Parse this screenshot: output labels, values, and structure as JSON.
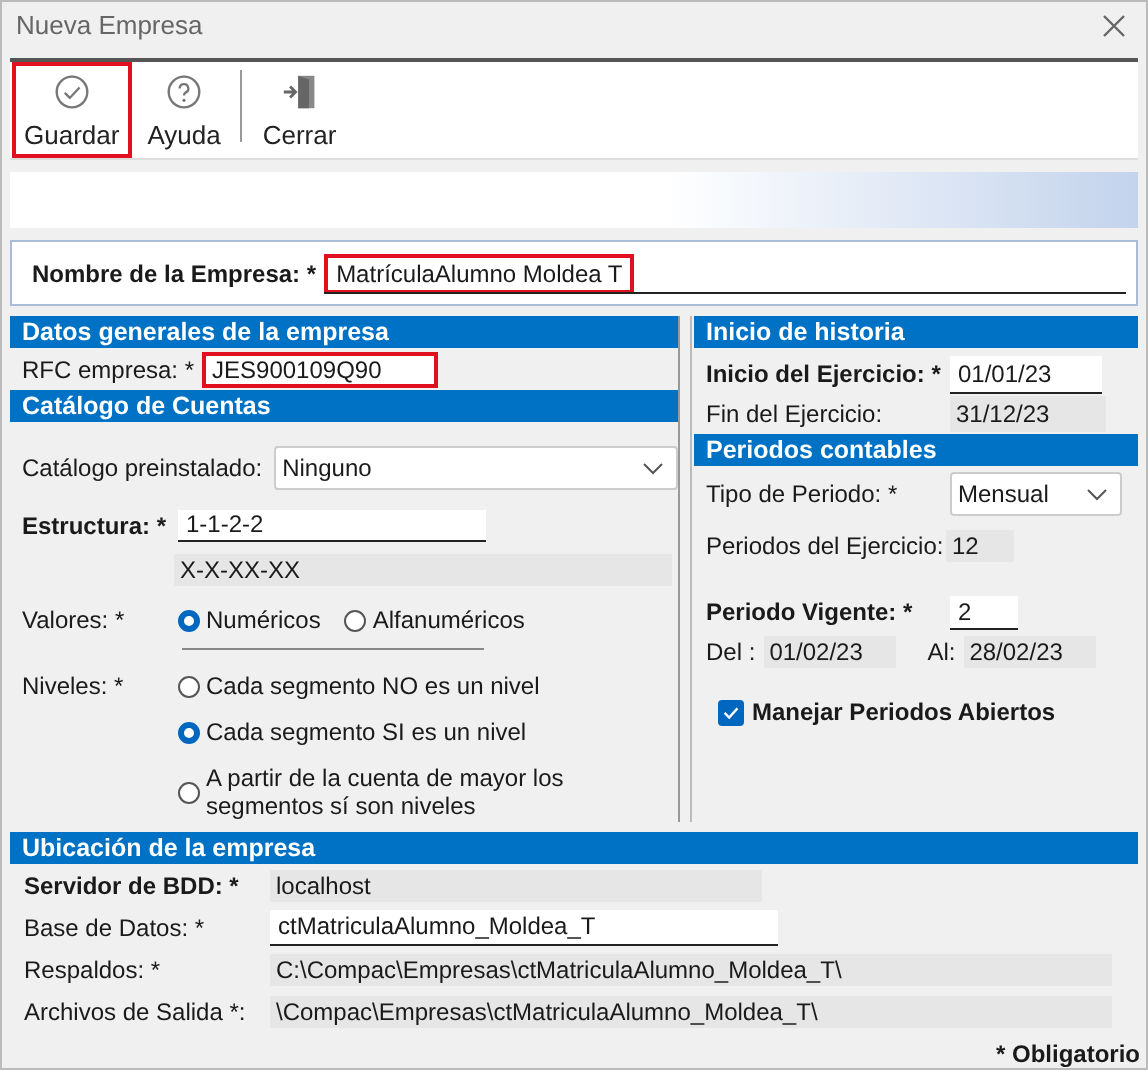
{
  "window": {
    "title": "Nueva Empresa"
  },
  "toolbar": [
    {
      "label": "Guardar",
      "kind": "check",
      "highlighted": true
    },
    {
      "label": "Ayuda",
      "kind": "help",
      "highlighted": false
    },
    {
      "label": "Cerrar",
      "kind": "exit",
      "highlighted": false
    }
  ],
  "company_name": {
    "label": "Nombre de la Empresa: *",
    "value": "MatrículaAlumno Moldea T",
    "highlighted": true
  },
  "general": {
    "title": "Datos generales de la empresa",
    "rfc": {
      "label": "RFC empresa: *",
      "value": "JES900109Q90",
      "highlighted": true
    }
  },
  "catalog": {
    "title": "Catálogo de Cuentas",
    "preinstalled": {
      "label": "Catálogo preinstalado:",
      "value": "Ninguno"
    },
    "structure": {
      "label": "Estructura: *",
      "value": "1-1-2-2",
      "mask": "X-X-XX-XX"
    },
    "values": {
      "label": "Valores: *",
      "options": [
        {
          "label": "Numéricos",
          "selected": true
        },
        {
          "label": "Alfanuméricos",
          "selected": false
        }
      ]
    },
    "levels": {
      "label": "Niveles: *",
      "options": [
        {
          "label": "Cada segmento NO es un nivel",
          "selected": false
        },
        {
          "label": "Cada segmento SI es un nivel",
          "selected": true
        },
        {
          "label": "A partir de la cuenta de mayor los segmentos sí son niveles",
          "selected": false
        }
      ]
    }
  },
  "history": {
    "title": "Inicio de historia",
    "start": {
      "label": "Inicio del Ejercicio: *",
      "value": "01/01/23"
    },
    "end": {
      "label": "Fin del Ejercicio:",
      "value": "31/12/23"
    }
  },
  "periods": {
    "title": "Periodos contables",
    "type": {
      "label": "Tipo de Periodo: *",
      "value": "Mensual"
    },
    "count": {
      "label": "Periodos del Ejercicio:",
      "value": "12"
    },
    "current": {
      "label": "Periodo Vigente: *",
      "value": "2"
    },
    "from": {
      "label": "Del :",
      "value": "01/02/23"
    },
    "to": {
      "label": "Al:",
      "value": "28/02/23"
    },
    "open_periods": {
      "label": "Manejar Periodos Abiertos",
      "checked": true
    }
  },
  "location": {
    "title": "Ubicación de la empresa",
    "rows": [
      {
        "label": "Servidor de BDD: *",
        "value": "localhost",
        "kind": "readonly"
      },
      {
        "label": "Base de Datos: *",
        "value": "ctMatriculaAlumno_Moldea_T",
        "kind": "input"
      },
      {
        "label": "Respaldos: *",
        "value": "C:\\Compac\\Empresas\\ctMatriculaAlumno_Moldea_T\\",
        "kind": "readonly-wide"
      },
      {
        "label": "Archivos de Salida *:",
        "value": "\\Compac\\Empresas\\ctMatriculaAlumno_Moldea_T\\",
        "kind": "readonly-wide"
      }
    ]
  },
  "footer": "* Obligatorio"
}
